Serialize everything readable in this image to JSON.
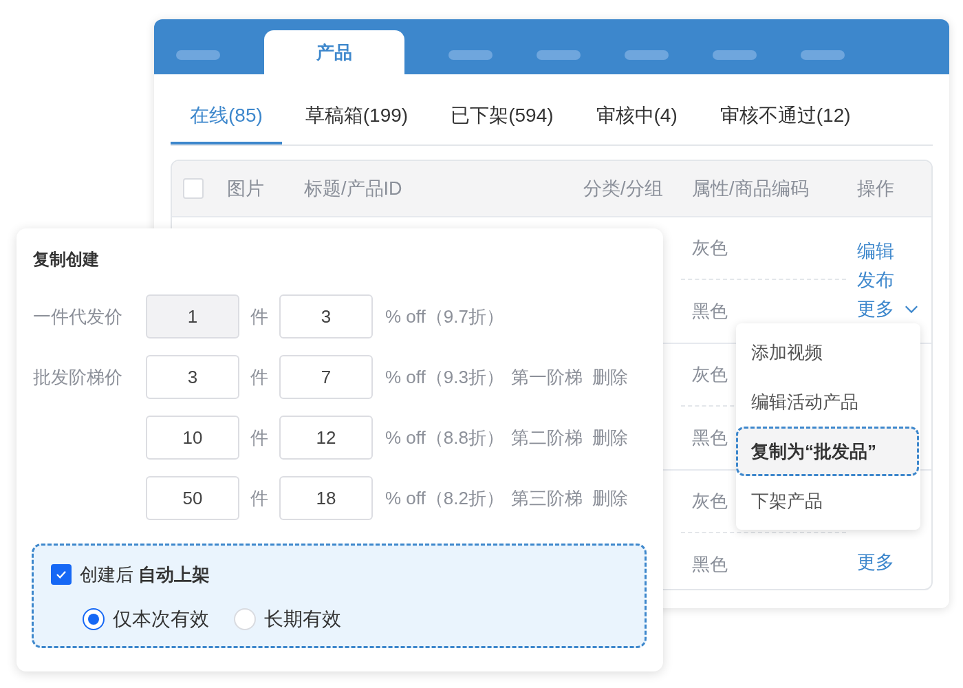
{
  "product_window": {
    "nav_tabs": [
      {
        "kind": "placeholder",
        "selected": false
      },
      {
        "kind": "tab",
        "label": "产品",
        "selected": true
      },
      {
        "kind": "placeholder",
        "selected": false
      },
      {
        "kind": "placeholder",
        "selected": false
      },
      {
        "kind": "placeholder",
        "selected": false
      },
      {
        "kind": "placeholder",
        "selected": false
      },
      {
        "kind": "placeholder",
        "selected": false
      }
    ],
    "status_tabs": [
      {
        "label": "在线(85)",
        "selected": true
      },
      {
        "label": "草稿箱(199)",
        "selected": false
      },
      {
        "label": "已下架(594)",
        "selected": false
      },
      {
        "label": "审核中(4)",
        "selected": false
      },
      {
        "label": "审核不通过(12)",
        "selected": false
      }
    ],
    "table": {
      "select_all": {
        "checked": false
      },
      "columns": [
        "图片",
        "标题/产品ID",
        "分类/分组",
        "属性/商品编码",
        "操作"
      ],
      "rows": [
        {
          "variants": [
            "灰色",
            "黑色"
          ],
          "actions": [
            {
              "kind": "link",
              "label": "编辑"
            },
            {
              "kind": "link",
              "label": "发布"
            },
            {
              "kind": "dropdown",
              "label": "更多"
            }
          ]
        },
        {
          "variants": [
            "灰色",
            "黑色"
          ],
          "actions": []
        },
        {
          "variants": [
            "灰色",
            "黑色"
          ],
          "actions": [
            {
              "kind": "link",
              "label": "更多"
            }
          ]
        }
      ]
    }
  },
  "more_menu": {
    "items": [
      {
        "label": "添加视频",
        "selected": false
      },
      {
        "label": "编辑活动产品",
        "selected": false
      },
      {
        "label": "复制为“批发品”",
        "selected": true
      },
      {
        "label": "下架产品",
        "selected": false
      }
    ]
  },
  "copy_dialog": {
    "title": "复制创建",
    "price_rows": [
      {
        "label": "一件代发价",
        "quantity": "1",
        "disabled": true,
        "unit": "件",
        "discount": "3",
        "summary": "% off（9.7折）"
      },
      {
        "label": "批发阶梯价",
        "quantity": "3",
        "disabled": false,
        "unit": "件",
        "discount": "7",
        "summary": "% off（9.3折）",
        "tier": "第一阶梯",
        "delete": "删除"
      },
      {
        "quantity": "10",
        "disabled": false,
        "unit": "件",
        "discount": "12",
        "summary": "% off（8.8折）",
        "tier": "第二阶梯",
        "delete": "删除"
      },
      {
        "quantity": "50",
        "disabled": false,
        "unit": "件",
        "discount": "18",
        "summary": "% off（8.2折）",
        "tier": "第三阶梯",
        "delete": "删除"
      }
    ],
    "auto_list": {
      "checked": true,
      "label": "创建后 **自动上架**",
      "options": [
        {
          "label": "仅本次有效",
          "selected": true
        },
        {
          "label": "长期有效",
          "selected": false
        }
      ]
    }
  }
}
